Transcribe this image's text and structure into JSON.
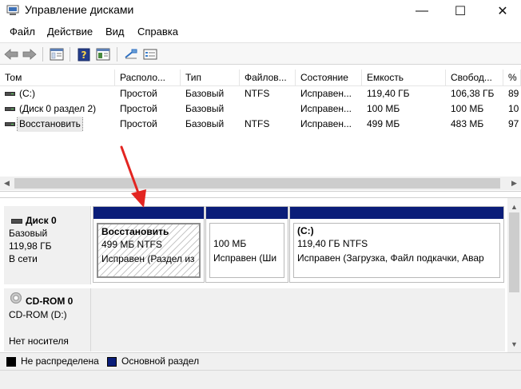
{
  "window": {
    "title": "Управление дисками",
    "minimize": "—",
    "maximize": "☐",
    "close": "✕"
  },
  "menu": [
    "Файл",
    "Действие",
    "Вид",
    "Справка"
  ],
  "toolbar": {
    "buttons": [
      "back-arrow-icon",
      "forward-arrow-icon",
      "console-tree-icon",
      "help-icon",
      "properties-icon",
      "rescan-icon",
      "list-view-icon"
    ]
  },
  "volumes": {
    "columns": [
      "Том",
      "Располо...",
      "Тип",
      "Файлов...",
      "Состояние",
      "Емкость",
      "Свобод...",
      "%"
    ],
    "rows": [
      [
        "(C:)",
        "Простой",
        "Базовый",
        "NTFS",
        "Исправен...",
        "119,40 ГБ",
        "106,38 ГБ",
        "89"
      ],
      [
        "(Диск 0 раздел 2)",
        "Простой",
        "Базовый",
        "",
        "Исправен...",
        "100 МБ",
        "100 МБ",
        "10"
      ],
      [
        "Восстановить",
        "Простой",
        "Базовый",
        "NTFS",
        "Исправен...",
        "499 МБ",
        "483 МБ",
        "97"
      ]
    ]
  },
  "disk0": {
    "name": "Диск 0",
    "type": "Базовый",
    "size": "119,98 ГБ",
    "status": "В сети",
    "partitions": [
      {
        "title": "Восстановить",
        "size": "499 МБ NTFS",
        "status": "Исправен (Раздел из"
      },
      {
        "title": "",
        "size": "100 МБ",
        "status": "Исправен (Ши"
      },
      {
        "title": "(C:)",
        "size": "119,40 ГБ NTFS",
        "status": "Исправен (Загрузка, Файл подкачки, Авар"
      }
    ]
  },
  "cdrom": {
    "name": "CD-ROM 0",
    "drive": "CD-ROM (D:)",
    "status": "Нет носителя"
  },
  "legend": {
    "unallocated": "Не распределена",
    "unallocated_color": "#000000",
    "primary": "Основной раздел",
    "primary_color": "#0a1d79"
  },
  "annotation": {
    "arrow_color": "#e32521"
  }
}
